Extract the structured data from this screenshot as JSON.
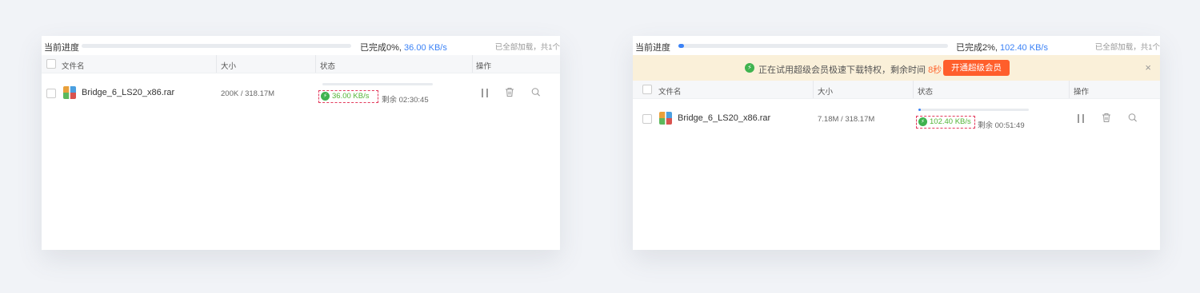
{
  "left": {
    "header": {
      "label": "当前进度",
      "done_prefix": "已完成0%,",
      "speed": "36.00 KB/s",
      "progress_percent": 0,
      "loaded": "已全部加载，共1个"
    },
    "columns": {
      "name": "文件名",
      "size": "大小",
      "status": "状态",
      "ops": "操作"
    },
    "file": {
      "name": "Bridge_6_LS20_x86.rar",
      "size": "200K / 318.17M",
      "progress_percent": 0,
      "speed": "36.00 KB/s",
      "remaining": "剩余 02:30:45"
    }
  },
  "right": {
    "header": {
      "label": "当前进度",
      "done_prefix": "已完成2%,",
      "speed": "102.40 KB/s",
      "progress_percent": 2,
      "loaded": "已全部加载，共1个"
    },
    "banner": {
      "message": "正在试用超级会员极速下载特权，剩余时间",
      "seconds": "8秒",
      "button": "开通超级会员",
      "close": "×"
    },
    "columns": {
      "name": "文件名",
      "size": "大小",
      "status": "状态",
      "ops": "操作"
    },
    "file": {
      "name": "Bridge_6_LS20_x86.rar",
      "size": "7.18M / 318.17M",
      "progress_percent": 2,
      "speed": "102.40 KB/s",
      "remaining": "剩余 00:51:49"
    }
  },
  "icons": {
    "bolt": "⚡",
    "pause": "pause-icon",
    "delete": "trash-icon",
    "locate": "search-icon",
    "file": "rar-archive-icon"
  },
  "colors": {
    "accent": "#3b82f6",
    "speed_green": "#52b436",
    "vip_orange": "#ff5e2b",
    "highlight_dash": "#e33a5c",
    "banner_bg": "#faf0d9"
  }
}
